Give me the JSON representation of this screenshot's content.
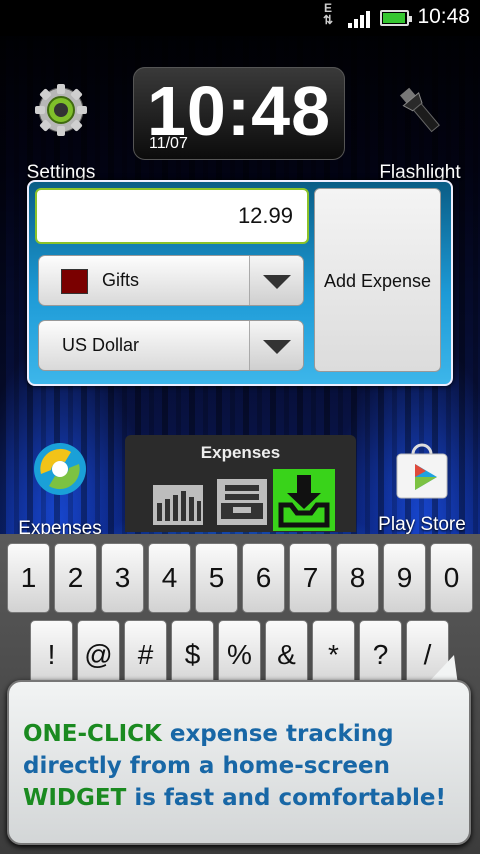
{
  "status": {
    "network_type": "E",
    "time": "10:48",
    "battery_color": "#36c631"
  },
  "clock": {
    "time": "10:48",
    "date": "11/07"
  },
  "home": {
    "settings_label": "Settings",
    "flashlight_label": "Flashlight",
    "expenses_label": "Expenses",
    "playstore_label": "Play Store"
  },
  "widget": {
    "amount": "12.99",
    "category": "Gifts",
    "category_color": "#7a0000",
    "currency": "US Dollar",
    "add_button": "Add Expense"
  },
  "expenses_widget": {
    "title": "Expenses",
    "buttons": [
      "chart-icon",
      "inbox-tray-icon",
      "download-icon"
    ]
  },
  "keyboard": {
    "row1": [
      "1",
      "2",
      "3",
      "4",
      "5",
      "6",
      "7",
      "8",
      "9",
      "0"
    ],
    "row2": [
      "!",
      "@",
      "#",
      "$",
      "%",
      "&",
      "*",
      "?",
      "/"
    ]
  },
  "promo": {
    "h1": "ONE-CLICK",
    "t1": " expense tracking directly from a home-screen ",
    "h2": "WIDGET",
    "t2": " is fast and comfortable!"
  }
}
